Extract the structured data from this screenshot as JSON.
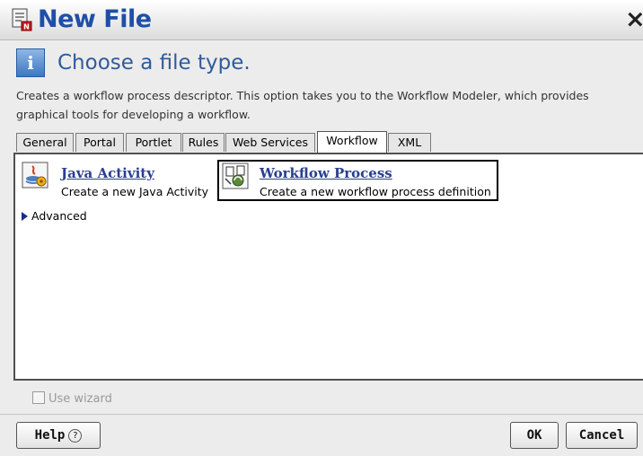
{
  "window": {
    "title": "New File",
    "close_glyph": "×"
  },
  "header": {
    "icon_glyph": "i",
    "title": "Choose a file type.",
    "description": "Creates a workflow process descriptor.  This option takes you to the Workflow Modeler, which provides graphical tools for developing a workflow."
  },
  "tabs": [
    {
      "label": "General"
    },
    {
      "label": "Portal"
    },
    {
      "label": "Portlet"
    },
    {
      "label": "Rules"
    },
    {
      "label": "Web Services"
    },
    {
      "label": "Workflow",
      "active": true
    },
    {
      "label": "XML"
    }
  ],
  "items": [
    {
      "title": "Java Activity",
      "description": "Create a new Java Activity",
      "icon": "java-activity-icon"
    },
    {
      "title": "Workflow Process",
      "description": "Create a new workflow process definition",
      "icon": "workflow-process-icon",
      "selected": true
    }
  ],
  "advanced": {
    "label": "Advanced"
  },
  "use_wizard": {
    "label": "Use wizard",
    "checked": false,
    "enabled": false
  },
  "buttons": {
    "help": "Help",
    "help_glyph": "?",
    "ok": "OK",
    "cancel": "Cancel"
  }
}
